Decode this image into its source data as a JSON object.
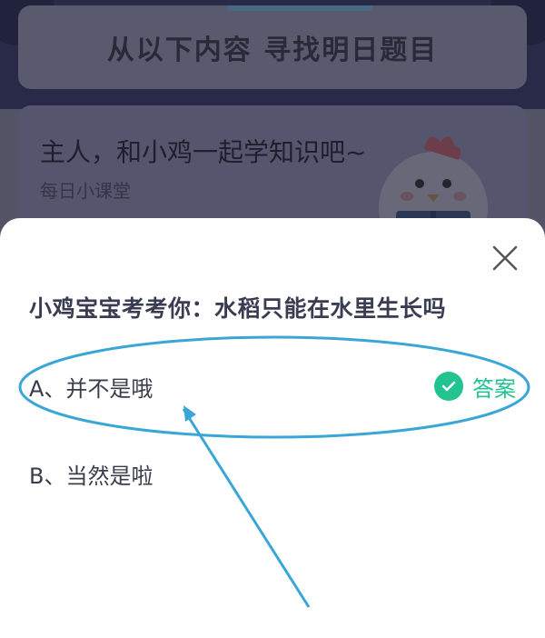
{
  "background": {
    "banner_title": "从以下内容 寻找明日题目",
    "lesson_title": "主人，和小鸡一起学知识吧~",
    "lesson_subtitle": "每日小课堂"
  },
  "modal": {
    "question": "小鸡宝宝考考你：水稻只能在水里生长吗",
    "close_icon": "close-icon",
    "options": [
      {
        "label": "A、并不是哦",
        "is_answer": true,
        "answer_label": "答案"
      },
      {
        "label": "B、当然是啦",
        "is_answer": false
      }
    ]
  },
  "colors": {
    "accent_green": "#23c38f",
    "annotation_blue": "#3aa6d8",
    "question_text": "#3a3c52"
  }
}
